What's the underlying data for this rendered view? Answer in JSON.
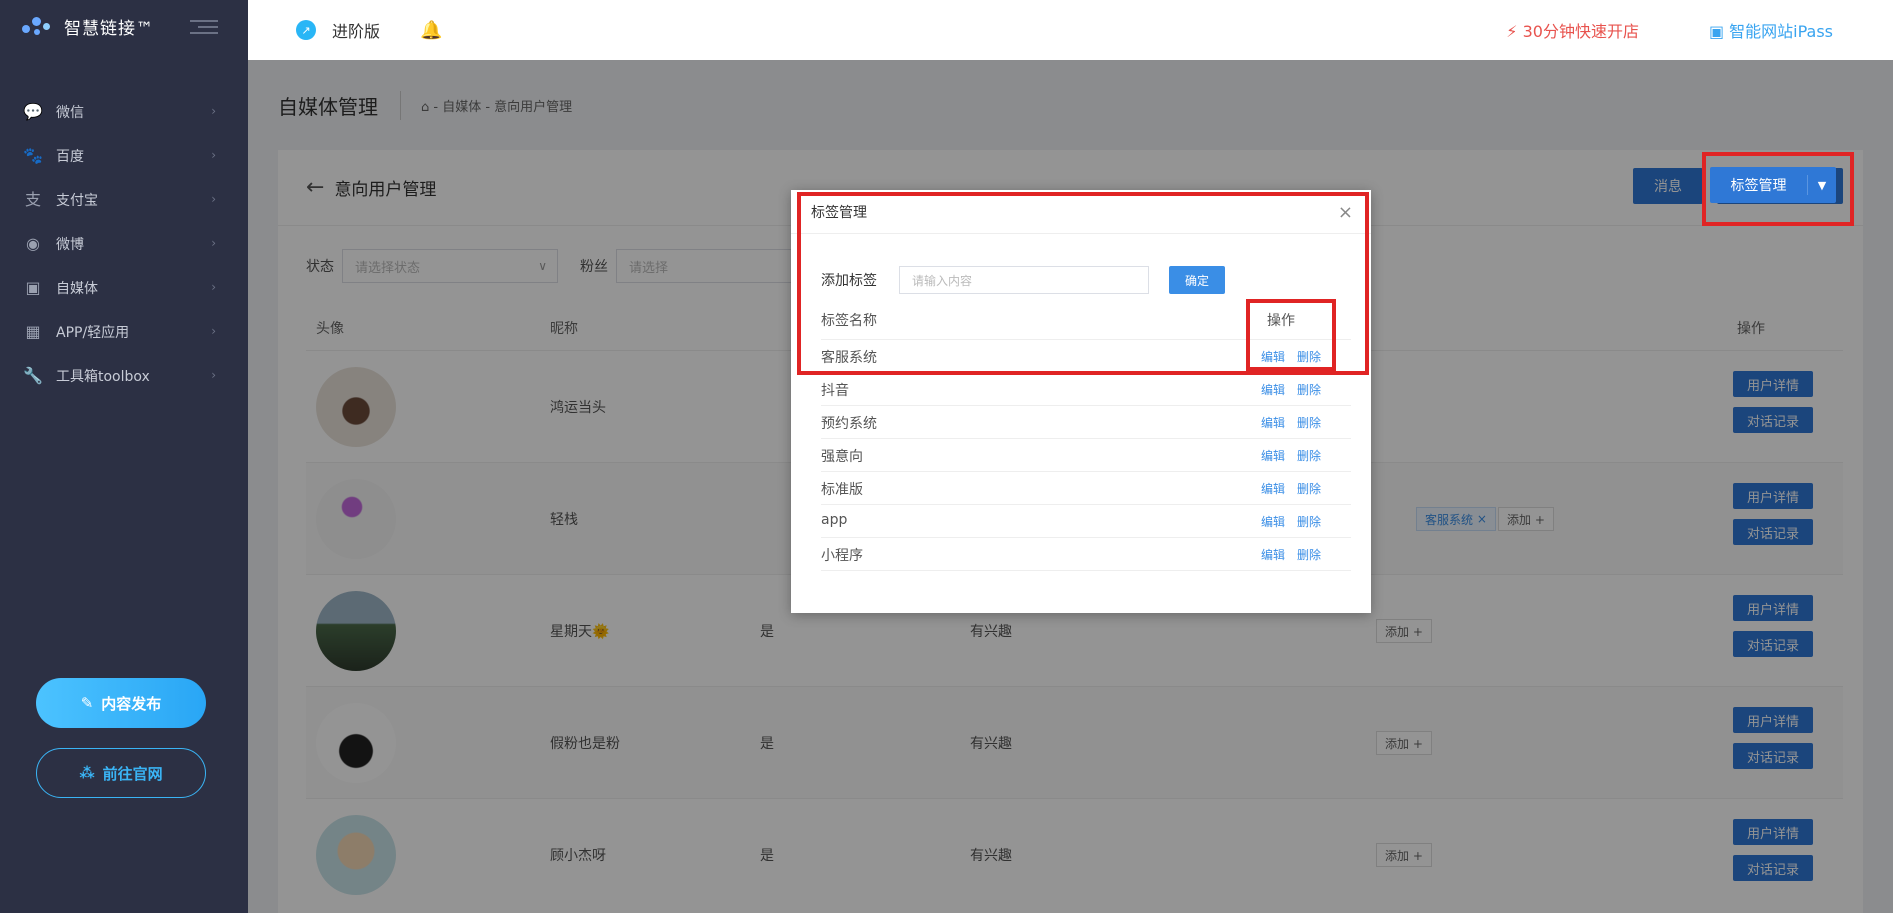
{
  "app": {
    "logo_text": "智慧链接™"
  },
  "sidebar": {
    "items": [
      {
        "label": "微信",
        "icon": "wechat-icon"
      },
      {
        "label": "百度",
        "icon": "paw-icon"
      },
      {
        "label": "支付宝",
        "icon": "alipay-icon"
      },
      {
        "label": "微博",
        "icon": "weibo-icon"
      },
      {
        "label": "自媒体",
        "icon": "media-icon"
      },
      {
        "label": "APP/轻应用",
        "icon": "app-grid-icon"
      },
      {
        "label": "工具箱toolbox",
        "icon": "wrench-icon"
      }
    ],
    "publish_label": "内容发布",
    "site_label": "前往官网"
  },
  "topbar": {
    "version": "进阶版",
    "fast_open": "30分钟快速开店",
    "ipass": "智能网站iPass"
  },
  "page": {
    "title": "自媒体管理",
    "breadcrumb": "⌂ - 自媒体 - 意向用户管理",
    "card_title": "意向用户管理",
    "message_btn": "消息",
    "tag_btn": "标签管理"
  },
  "filters": {
    "status_label": "状态",
    "status_placeholder": "请选择状态",
    "fans_label": "粉丝",
    "fans_placeholder": "请选择"
  },
  "table": {
    "headers": {
      "avatar": "头像",
      "nickname": "昵称",
      "ops": "操作"
    },
    "rows": [
      {
        "nickname": "鸿运当头",
        "is": "",
        "interest": "",
        "tags": []
      },
      {
        "nickname": "轻栈",
        "is": "",
        "interest": "",
        "tags": [
          "客服系统"
        ]
      },
      {
        "nickname": "星期天🌞",
        "is": "是",
        "interest": "有兴趣",
        "tags": []
      },
      {
        "nickname": "假粉也是粉",
        "is": "是",
        "interest": "有兴趣",
        "tags": []
      },
      {
        "nickname": "顾小杰呀",
        "is": "是",
        "interest": "有兴趣",
        "tags": []
      }
    ],
    "add_label": "添加 +",
    "detail_btn": "用户详情",
    "chat_btn": "对话记录"
  },
  "modal": {
    "title": "标签管理",
    "add_label": "添加标签",
    "input_placeholder": "请输入内容",
    "ok_label": "确定",
    "col_name": "标签名称",
    "col_ops": "操作",
    "edit_label": "编辑",
    "delete_label": "删除",
    "tags": [
      "客服系统",
      "抖音",
      "预约系统",
      "强意向",
      "标准版",
      "app",
      "小程序"
    ]
  },
  "colors": {
    "primary": "#2f78d6",
    "highlight": "#e02424",
    "sidebar": "#2c3044"
  }
}
